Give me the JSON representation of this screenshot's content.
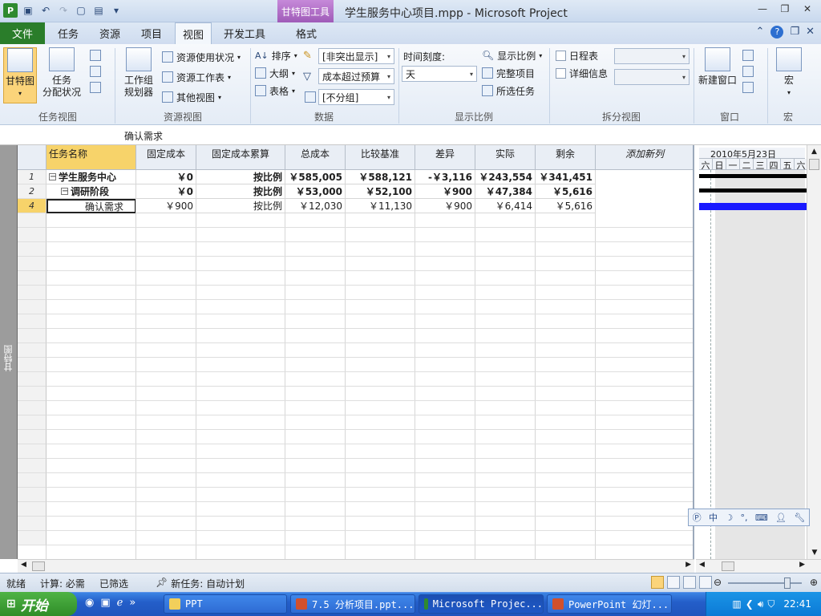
{
  "titlebar": {
    "context_tab": "甘特图工具",
    "document_title": "学生服务中心项目.mpp - Microsoft Project"
  },
  "tabs": {
    "file": "文件",
    "items": [
      "任务",
      "资源",
      "项目",
      "视图",
      "开发工具",
      "格式"
    ],
    "active": "视图"
  },
  "ribbon": {
    "task_views": {
      "gantt": "甘特图",
      "task_usage_line1": "任务",
      "task_usage_line2": "分配状况",
      "label": "任务视图"
    },
    "resource_views": {
      "team_planner_line1": "工作组",
      "team_planner_line2": "规划器",
      "resource_usage": "资源使用状况",
      "resource_sheet": "资源工作表",
      "other_views": "其他视图",
      "label": "资源视图"
    },
    "data": {
      "sort": "排序",
      "outline": "大纲",
      "tables": "表格",
      "highlight": "[非突出显示]",
      "filter": "成本超过预算",
      "group": "[不分组]",
      "label": "数据"
    },
    "zoom": {
      "timescale_label": "时间刻度:",
      "timescale_value": "天",
      "zoom": "显示比例",
      "entire_project": "完整项目",
      "selected_tasks": "所选任务",
      "label": "显示比例"
    },
    "split_view": {
      "timeline": "日程表",
      "details": "详细信息",
      "label": "拆分视图"
    },
    "window": {
      "new_window": "新建窗口",
      "label": "窗口"
    },
    "macros": {
      "macros": "宏",
      "label": "宏"
    }
  },
  "entry_bar": {
    "value": "确认需求"
  },
  "view_bar": {
    "label": "甘特图"
  },
  "table": {
    "headers": [
      "任务名称",
      "固定成本",
      "固定成本累算",
      "总成本",
      "比较基准",
      "差异",
      "实际",
      "剩余",
      "添加新列"
    ],
    "rows": [
      {
        "id": "1",
        "name": "学生服务中心",
        "fixed_cost": "￥0",
        "accrual": "按比例",
        "total": "￥585,005",
        "baseline": "￥588,121",
        "variance": "-￥3,116",
        "actual": "￥243,554",
        "remaining": "￥341,451"
      },
      {
        "id": "2",
        "name": "调研阶段",
        "fixed_cost": "￥0",
        "accrual": "按比例",
        "total": "￥53,000",
        "baseline": "￥52,100",
        "variance": "￥900",
        "actual": "￥47,384",
        "remaining": "￥5,616"
      },
      {
        "id": "4",
        "name": "确认需求",
        "fixed_cost": "￥900",
        "accrual": "按比例",
        "total": "￥12,030",
        "baseline": "￥11,130",
        "variance": "￥900",
        "actual": "￥6,414",
        "remaining": "￥5,616"
      }
    ]
  },
  "gantt": {
    "week_label": "2010年5月23日",
    "days": [
      "六",
      "日",
      "一",
      "二",
      "三",
      "四",
      "五",
      "六"
    ],
    "bar_colors": {
      "summary": "#000000",
      "task": "#1a1aff"
    }
  },
  "statusbar": {
    "ready": "就绪",
    "calc": "计算: 必需",
    "filtered": "已筛选",
    "new_tasks": "新任务: 自动计划"
  },
  "taskbar": {
    "start": "开始",
    "items": [
      "PPT",
      "7.5 分析项目.ppt...",
      "Microsoft Projec...",
      "PowerPoint 幻灯..."
    ],
    "clock": "22:41"
  },
  "ime": {
    "lang": "中"
  }
}
